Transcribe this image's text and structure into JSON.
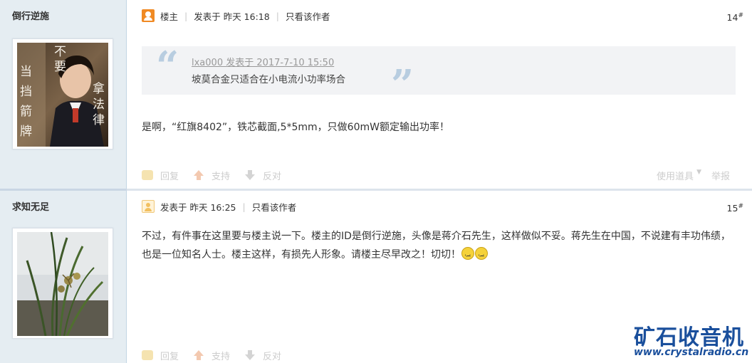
{
  "posts": [
    {
      "author": "倒行逆施",
      "is_owner": true,
      "owner_label": "楼主",
      "posted_at": "发表于 昨天 16:18",
      "only_author": "只看该作者",
      "floor_num": "14",
      "floor_mark": "#",
      "quote": {
        "head": "lxa000 发表于 2017-7-10 15:50",
        "text": "坡莫合金只适合在小电流小功率场合"
      },
      "content": "是啊，“红旗8402”，铁芯截面,5*5mm，只做60mW额定输出功率！",
      "actions": {
        "reply": "回复",
        "support": "支持",
        "oppose": "反对"
      },
      "tools": {
        "use_tool": "使用道具",
        "report": "举报"
      }
    },
    {
      "author": "求知无足",
      "posted_at": "发表于 昨天 16:25",
      "only_author": "只看该作者",
      "floor_num": "15",
      "floor_mark": "#",
      "content": "不过，有件事在这里要与楼主说一下。楼主的ID是倒行逆施，头像是蒋介石先生，这样做似不妥。蒋先生在中国，不说建有丰功伟绩，也是一位知名人士。楼主这样，有损先人形象。请楼主尽早改之！切切！",
      "actions": {
        "reply": "回复",
        "support": "支持",
        "oppose": "反对"
      }
    }
  ],
  "avatar1_text": [
    "不",
    "要",
    "拿",
    "法",
    "律",
    "当",
    "挡",
    "箭",
    "牌"
  ],
  "watermark": {
    "title": "矿石收音机",
    "url": "www.crystalradio.cn"
  },
  "colors": {
    "sidebar_bg": "#e5edf2",
    "quote_mark": "#b8cde0",
    "watermark": "#1a4f9c"
  }
}
